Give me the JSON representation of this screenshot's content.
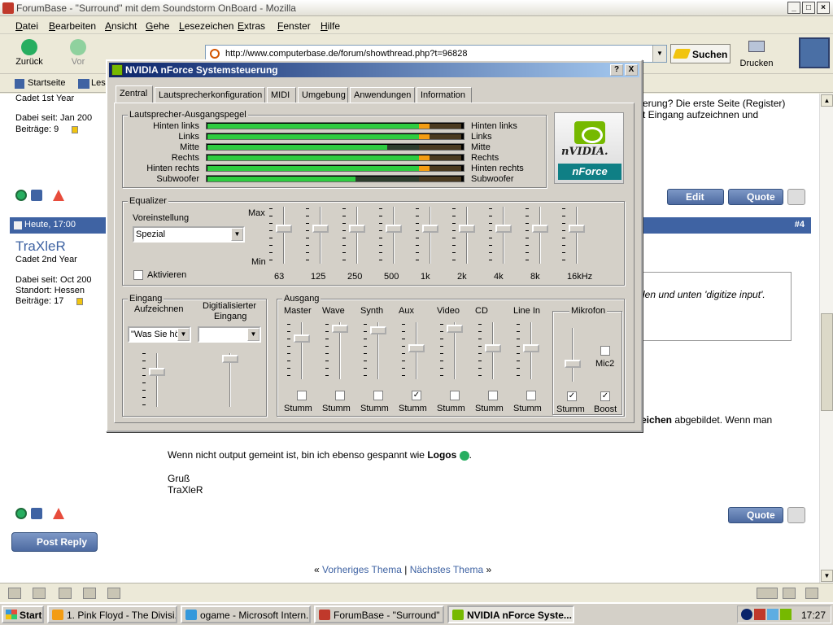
{
  "window": {
    "title": "ForumBase - \"Surround\" mit dem Soundstorm OnBoard - Mozilla"
  },
  "menu": [
    "Datei",
    "Bearbeiten",
    "Ansicht",
    "Gehe",
    "Lesezeichen",
    "Extras",
    "Fenster",
    "Hilfe"
  ],
  "nav": {
    "back": "Zurück",
    "forward": "Vor",
    "url": "http://www.computerbase.de/forum/showthread.php?t=96828",
    "search": "Suchen",
    "print": "Drucken"
  },
  "bookmarks": {
    "home": "Startseite",
    "les": "Les"
  },
  "forum": {
    "user1": {
      "rank": "Cadet 1st Year",
      "joined": "Dabei seit: Jan 200",
      "posts": "Beiträge: 9"
    },
    "text_top1": "erung? Die erste Seite (Register)",
    "text_top2": "t Eingang aufzeichnen und",
    "edit": "Edit",
    "quote": "Quote",
    "post_date": "Heute, 17:00",
    "post_num": "#4",
    "user2": {
      "name": "TraXleR",
      "rank": "Cadet 2nd Year",
      "joined": "Dabei seit: Oct 200",
      "location": "Standort: Hessen",
      "posts": "Beiträge: 17"
    },
    "quote_text": "len und unten 'digitize input'.",
    "line1_bold": "eichen",
    "line1_rest": " abgebildet. Wenn man",
    "line2_pre": "Wenn nicht output gemeint ist, bin ich ebenso gespannt wie ",
    "line2_bold": "Logos",
    "greeting": "Gruß",
    "signature": "TraXleR",
    "post_reply": "Post Reply",
    "prev_thread": "Vorheriges Thema",
    "sep": "|",
    "next_thread": "Nächstes Thema",
    "laquo": "«",
    "raquo": "»"
  },
  "taskbar": {
    "start": "Start",
    "items": [
      "1. Pink Floyd - The Divisi...",
      "ogame - Microsoft Intern...",
      "ForumBase - \"Surround\" ...",
      "NVIDIA nForce Syste..."
    ],
    "clock": "17:27"
  },
  "dialog": {
    "title": "NVIDIA nForce Systemsteuerung",
    "help": "?",
    "close": "X",
    "tabs": [
      "Zentral",
      "Lautsprecherkonfiguration",
      "MIDI",
      "Umgebung",
      "Anwendungen",
      "Information"
    ],
    "levels_group": "Lautsprecher-Ausgangspegel",
    "channels": [
      {
        "left": "Hinten links",
        "right": "Hinten links",
        "level": 0.86
      },
      {
        "left": "Links",
        "right": "Links",
        "level": 0.86
      },
      {
        "left": "Mitte",
        "right": "Mitte",
        "level": 0.72
      },
      {
        "left": "Rechts",
        "right": "Rechts",
        "level": 0.86
      },
      {
        "left": "Hinten rechts",
        "right": "Hinten rechts",
        "level": 0.86
      },
      {
        "left": "Subwoofer",
        "right": "Subwoofer",
        "level": 0.6
      }
    ],
    "logo_brand": "nVIDIA.",
    "logo_product": "nForce",
    "equalizer": {
      "label": "Equalizer",
      "preset_label": "Voreinstellung",
      "preset": "Spezial",
      "max": "Max",
      "min": "Min",
      "activate": "Aktivieren",
      "bands": [
        "63",
        "125",
        "250",
        "500",
        "1k",
        "2k",
        "4k",
        "8k",
        "16kHz"
      ]
    },
    "input": {
      "label": "Eingang",
      "record": "Aufzeichnen",
      "digitized": "Digitialisierter",
      "digitized2": "Eingang",
      "record_value": "\"Was Sie hö",
      "digitized_value": ""
    },
    "output": {
      "label": "Ausgang",
      "channels": [
        {
          "name": "Master",
          "mute": "Stumm",
          "muted": false,
          "level": 0.75
        },
        {
          "name": "Wave",
          "mute": "Stumm",
          "muted": false,
          "level": 0.95
        },
        {
          "name": "Synth",
          "mute": "Stumm",
          "muted": false,
          "level": 0.92
        },
        {
          "name": "Aux",
          "mute": "Stumm",
          "muted": true,
          "level": 0.55
        },
        {
          "name": "Video",
          "mute": "Stumm",
          "muted": false,
          "level": 0.95
        },
        {
          "name": "CD",
          "mute": "Stumm",
          "muted": false,
          "level": 0.55
        },
        {
          "name": "Line In",
          "mute": "Stumm",
          "muted": false,
          "level": 0.55
        }
      ],
      "mic": {
        "label": "Mikrofon",
        "mute": "Stumm",
        "muted": true,
        "boost": "Boost",
        "boosted": true,
        "mic2": "Mic2",
        "mic2_on": false,
        "level": 0.3
      }
    }
  }
}
